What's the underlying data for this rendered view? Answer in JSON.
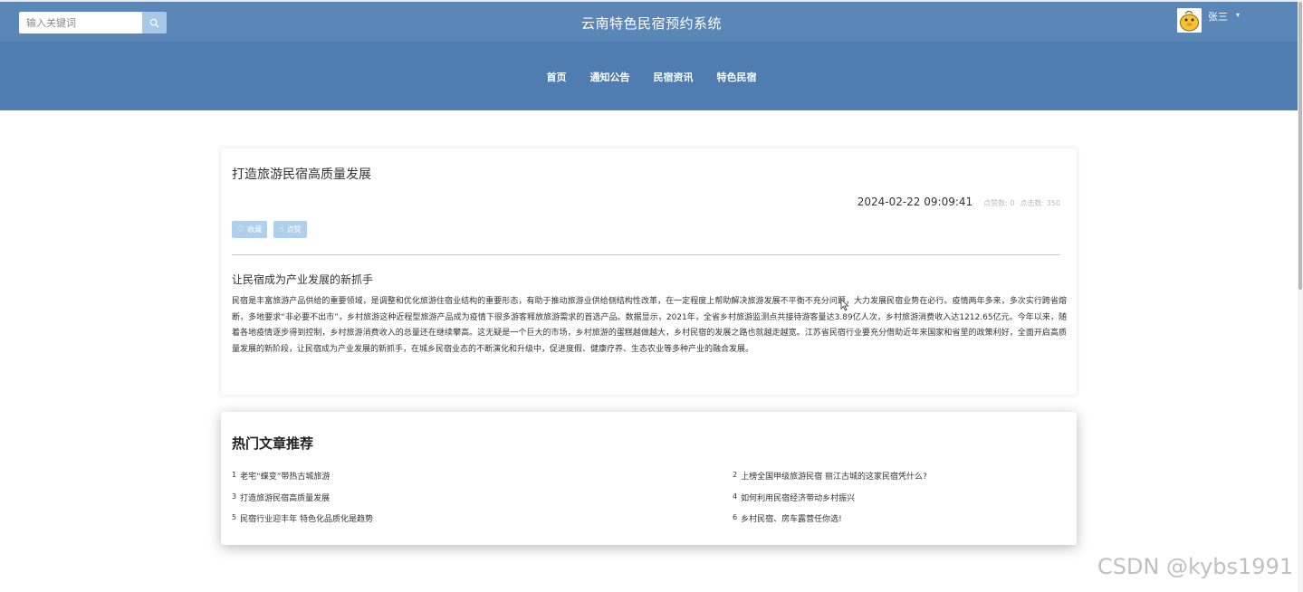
{
  "header": {
    "search_placeholder": "输入关键词",
    "site_title": "云南特色民宿预约系统",
    "user_name": "张三",
    "user_caret": "▾"
  },
  "nav": {
    "items": [
      "首页",
      "通知公告",
      "民宿资讯",
      "特色民宿"
    ]
  },
  "article": {
    "title": "打造旅游民宿高质量发展",
    "date": "2024-02-22 09:09:41",
    "likes_label": "点赞数: 0",
    "clicks_label": "点击数: 350",
    "buttons": {
      "favorite": "收藏",
      "like": "点赞"
    },
    "subtitle": "让民宿成为产业发展的新抓手",
    "body": "民宿是丰富旅游产品供给的重要领域，是调整和优化旅游住宿业结构的重要形态，有助于推动旅游业供给侧结构性改革，在一定程度上帮助解决旅游发展不平衡不充分问题，大力发展民宿业势在必行。疫情两年多来，多次实行跨省熔断，多地要求“非必要不出市”，乡村旅游这种近程型旅游产品成为疫情下很多游客释放旅游需求的首选产品。数据显示，2021年，全省乡村旅游监测点共接待游客量达3.89亿人次，乡村旅游消费收入达1212.65亿元。今年以来，随着各地疫情逐步得到控制，乡村旅游消费收入的总量还在继续攀高。这无疑是一个巨大的市场，乡村旅游的蛋糕越做越大，乡村民宿的发展之路也就越走越宽。江苏省民宿行业要充分借助近年来国家和省里的政策利好，全面开启高质量发展的新阶段，让民宿成为产业发展的新抓手，在城乡民宿业态的不断演化和升级中，促进度假、健康疗养、生态农业等多种产业的融合发展。"
  },
  "hot": {
    "title": "热门文章推荐",
    "items": [
      {
        "num": "1",
        "text": "老宅“蝶变”带热古城旅游"
      },
      {
        "num": "2",
        "text": "上榜全国甲级旅游民宿 丽江古城的这家民宿凭什么?"
      },
      {
        "num": "3",
        "text": "打造旅游民宿高质量发展"
      },
      {
        "num": "4",
        "text": "如何利用民宿经济带动乡村振兴"
      },
      {
        "num": "5",
        "text": "民宿行业迎丰年 特色化品质化是趋势"
      },
      {
        "num": "6",
        "text": "乡村民宿、房车露营任你选!"
      }
    ]
  },
  "watermark": "CSDN @kybs1991",
  "colors": {
    "topbar": "#5b86b8",
    "navbar": "#4f7cb1",
    "button": "#aed0ec"
  }
}
